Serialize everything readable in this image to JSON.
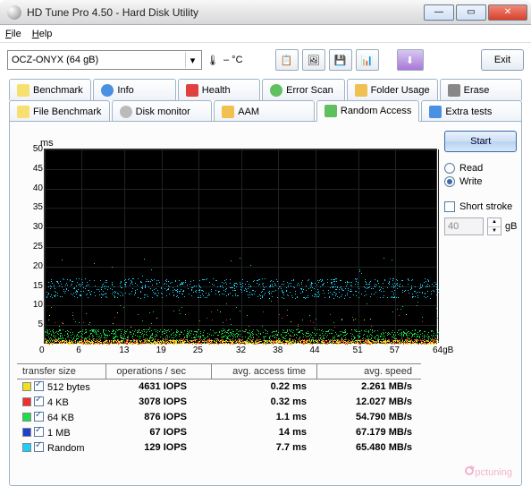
{
  "window": {
    "title": "HD Tune Pro 4.50 - Hard Disk Utility"
  },
  "menu": {
    "file": "File",
    "help": "Help"
  },
  "toolbar": {
    "drive": "OCZ-ONYX (64 gB)",
    "temp": "– °C",
    "exit": "Exit"
  },
  "tabs_top": [
    {
      "label": "Benchmark"
    },
    {
      "label": "Info"
    },
    {
      "label": "Health"
    },
    {
      "label": "Error Scan"
    },
    {
      "label": "Folder Usage"
    },
    {
      "label": "Erase"
    }
  ],
  "tabs_bottom": [
    {
      "label": "File Benchmark"
    },
    {
      "label": "Disk monitor"
    },
    {
      "label": "AAM"
    },
    {
      "label": "Random Access"
    },
    {
      "label": "Extra tests"
    }
  ],
  "side": {
    "start": "Start",
    "read": "Read",
    "write": "Write",
    "short_stroke": "Short stroke",
    "stroke_val": "40",
    "stroke_unit": "gB",
    "selected_mode": "write"
  },
  "chart_data": {
    "type": "scatter",
    "title": "",
    "xlabel": "gB",
    "ylabel": "ms",
    "xlim": [
      0,
      64
    ],
    "ylim": [
      0,
      50
    ],
    "x_ticks": [
      0,
      6,
      13,
      19,
      25,
      32,
      38,
      44,
      51,
      57,
      "64gB"
    ],
    "y_ticks": [
      5,
      10,
      15,
      20,
      25,
      30,
      35,
      40,
      45,
      50
    ],
    "axis_unit": "ms",
    "series": [
      {
        "name": "1 MB",
        "color": "#1ad0fa",
        "approx_band_ms": [
          12,
          17
        ],
        "iops": 67,
        "access_ms": 14,
        "speed_mbs": 67.179
      },
      {
        "name": "64 KB",
        "color": "#1ae04a",
        "approx_band_ms": [
          0.5,
          4
        ],
        "iops": 876,
        "access_ms": 1.1,
        "speed_mbs": 54.79
      },
      {
        "name": "4 KB",
        "color": "#f03030",
        "approx_band_ms": [
          0.2,
          1.5
        ],
        "iops": 3078,
        "access_ms": 0.32,
        "speed_mbs": 12.027
      },
      {
        "name": "512 bytes",
        "color": "#f0e020",
        "approx_band_ms": [
          0.1,
          1.2
        ],
        "iops": 4631,
        "access_ms": 0.22,
        "speed_mbs": 2.261
      },
      {
        "name": "Random",
        "color": "#1ad0fa",
        "iops": 129,
        "access_ms": 7.7,
        "speed_mbs": 65.48
      }
    ]
  },
  "table": {
    "headers": {
      "size": "transfer size",
      "ops": "operations / sec",
      "access": "avg. access time",
      "speed": "avg. speed"
    },
    "rows": [
      {
        "sw": "#f0e020",
        "size": "512 bytes",
        "ops": "4631 IOPS",
        "access": "0.22 ms",
        "speed": "2.261 MB/s"
      },
      {
        "sw": "#f03030",
        "size": "4 KB",
        "ops": "3078 IOPS",
        "access": "0.32 ms",
        "speed": "12.027 MB/s"
      },
      {
        "sw": "#1ae04a",
        "size": "64 KB",
        "ops": "876 IOPS",
        "access": "1.1 ms",
        "speed": "54.790 MB/s"
      },
      {
        "sw": "#2040d0",
        "size": "1 MB",
        "ops": "67 IOPS",
        "access": "14 ms",
        "speed": "67.179 MB/s"
      },
      {
        "sw": "#1ad0fa",
        "size": "Random",
        "ops": "129 IOPS",
        "access": "7.7 ms",
        "speed": "65.480 MB/s"
      }
    ]
  },
  "watermark": "pctuning"
}
